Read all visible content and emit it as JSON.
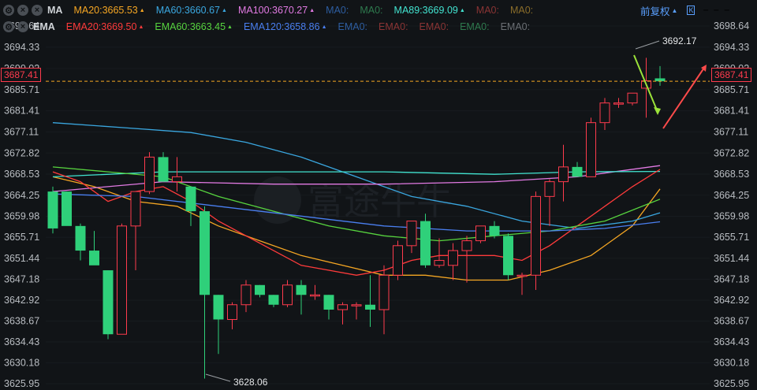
{
  "legend_ma": {
    "label": "MA",
    "items": [
      {
        "text": "MA20:3665.53",
        "color": "#f5a623",
        "arrow": "▲"
      },
      {
        "text": "MA60:3660.67",
        "color": "#3aa7e0",
        "arrow": "▲"
      },
      {
        "text": "MA100:3670.27",
        "color": "#e27ae3",
        "arrow": "▲"
      },
      {
        "text": "MA0:",
        "color": "#2d5da0",
        "arrow": ""
      },
      {
        "text": "MA0:",
        "color": "#2e7a4e",
        "arrow": ""
      },
      {
        "text": "MA89:3669.09",
        "color": "#42e3d0",
        "arrow": "▲"
      },
      {
        "text": "MA0:",
        "color": "#8a3434",
        "arrow": ""
      },
      {
        "text": "MA0:",
        "color": "#8a6d2a",
        "arrow": ""
      }
    ]
  },
  "legend_ema": {
    "label": "EMA",
    "items": [
      {
        "text": "EMA20:3669.50",
        "color": "#ff3b3b",
        "arrow": "▲"
      },
      {
        "text": "EMA60:3663.45",
        "color": "#57d43f",
        "arrow": "▲"
      },
      {
        "text": "EMA120:3658.86",
        "color": "#4a7ff0",
        "arrow": "▲"
      },
      {
        "text": "EMA0:",
        "color": "#2d5da0",
        "arrow": ""
      },
      {
        "text": "EMA0:",
        "color": "#8a3434",
        "arrow": ""
      },
      {
        "text": "EMA0:",
        "color": "#8a3434",
        "arrow": ""
      },
      {
        "text": "EMA0:",
        "color": "#2e7a4e",
        "arrow": ""
      },
      {
        "text": "EMA0:",
        "color": "#6b6f74",
        "arrow": ""
      }
    ]
  },
  "toolbar": {
    "adjust_label": "前复权",
    "collapse_icon": "chevron-up-icon",
    "kline_icon": "kline-icon"
  },
  "watermark": {
    "text": "富途牛牛"
  },
  "current_price": "3687.41",
  "annotations": {
    "high": "3692.17",
    "low": "3628.06"
  },
  "colors": {
    "up": "#ff3b4d",
    "down": "#2fd07a",
    "background": "#111417",
    "price_line": "#f5a623"
  },
  "chart_data": {
    "type": "candlestick",
    "ylim": [
      3625.95,
      3698.64
    ],
    "yticks": [
      "3698.64",
      "3694.33",
      "3690.02",
      "3685.71",
      "3681.41",
      "3677.11",
      "3672.82",
      "3668.53",
      "3664.25",
      "3659.98",
      "3655.71",
      "3651.44",
      "3647.18",
      "3642.92",
      "3638.67",
      "3634.43",
      "3630.18",
      "3625.95"
    ],
    "candles": [
      [
        3665.0,
        3666.0,
        3656.5,
        3657.5
      ],
      [
        3665.0,
        3665.0,
        3659.0,
        3658.0
      ],
      [
        3658.0,
        3658.5,
        3651.0,
        3653.0
      ],
      [
        3653.0,
        3657.0,
        3650.5,
        3650.0
      ],
      [
        3649.0,
        3649.0,
        3635.0,
        3636.0
      ],
      [
        3636.0,
        3658.5,
        3636.0,
        3658.0
      ],
      [
        3658.0,
        3665.0,
        3649.0,
        3665.0
      ],
      [
        3665.0,
        3673.0,
        3664.5,
        3672.0
      ],
      [
        3672.0,
        3673.0,
        3667.0,
        3667.0
      ],
      [
        3667.0,
        3672.0,
        3665.0,
        3668.0
      ],
      [
        3666.0,
        3666.0,
        3658.0,
        3661.0
      ],
      [
        3661.0,
        3662.0,
        3627.0,
        3644.0
      ],
      [
        3644.0,
        3644.0,
        3632.0,
        3639.0
      ],
      [
        3639.0,
        3642.5,
        3637.0,
        3642.0
      ],
      [
        3642.0,
        3647.0,
        3640.5,
        3646.0
      ],
      [
        3646.0,
        3646.0,
        3643.5,
        3644.0
      ],
      [
        3644.0,
        3644.0,
        3641.5,
        3642.0
      ],
      [
        3642.0,
        3647.0,
        3641.5,
        3646.0
      ],
      [
        3646.0,
        3647.0,
        3640.0,
        3644.0
      ],
      [
        3644.0,
        3646.0,
        3643.0,
        3644.0
      ],
      [
        3644.0,
        3644.0,
        3639.0,
        3641.0
      ],
      [
        3641.0,
        3642.5,
        3638.0,
        3642.0
      ],
      [
        3642.0,
        3642.5,
        3639.0,
        3642.0
      ],
      [
        3642.0,
        3648.0,
        3637.5,
        3641.0
      ],
      [
        3641.0,
        3650.0,
        3636.0,
        3648.0
      ],
      [
        3648.0,
        3655.0,
        3647.0,
        3654.0
      ],
      [
        3654.0,
        3659.0,
        3652.5,
        3659.0
      ],
      [
        3659.0,
        3660.5,
        3649.5,
        3650.0
      ],
      [
        3650.0,
        3655.5,
        3649.5,
        3651.0
      ],
      [
        3650.0,
        3654.5,
        3647.0,
        3653.0
      ],
      [
        3653.0,
        3656.0,
        3646.5,
        3655.0
      ],
      [
        3655.0,
        3658.0,
        3654.5,
        3658.0
      ],
      [
        3658.0,
        3659.0,
        3655.5,
        3656.0
      ],
      [
        3656.0,
        3656.5,
        3647.0,
        3648.0
      ],
      [
        3648.0,
        3648.5,
        3644.0,
        3648.0
      ],
      [
        3648.0,
        3665.0,
        3645.0,
        3664.0
      ],
      [
        3664.0,
        3667.5,
        3658.0,
        3667.0
      ],
      [
        3667.0,
        3674.5,
        3663.0,
        3670.0
      ],
      [
        3670.0,
        3671.0,
        3668.0,
        3668.0
      ],
      [
        3668.0,
        3680.0,
        3668.0,
        3679.0
      ],
      [
        3679.0,
        3684.0,
        3677.5,
        3683.0
      ],
      [
        3683.0,
        3684.0,
        3682.0,
        3683.0
      ],
      [
        3683.0,
        3685.0,
        3682.5,
        3685.0
      ],
      [
        3686.0,
        3692.17,
        3680.0,
        3687.5
      ],
      [
        3688.0,
        3690.5,
        3686.5,
        3687.41
      ]
    ],
    "lines": [
      {
        "name": "MA20",
        "color": "#f5a623",
        "points": [
          [
            0,
            3668
          ],
          [
            3,
            3666
          ],
          [
            6,
            3663
          ],
          [
            9,
            3662
          ],
          [
            12,
            3658
          ],
          [
            15,
            3655
          ],
          [
            18,
            3652
          ],
          [
            21,
            3650
          ],
          [
            24,
            3648
          ],
          [
            27,
            3648
          ],
          [
            30,
            3647
          ],
          [
            33,
            3647
          ],
          [
            36,
            3649
          ],
          [
            39,
            3652
          ],
          [
            42,
            3658
          ],
          [
            44,
            3665.53
          ]
        ]
      },
      {
        "name": "MA60",
        "color": "#3aa7e0",
        "points": [
          [
            0,
            3679
          ],
          [
            5,
            3678
          ],
          [
            10,
            3677
          ],
          [
            14,
            3675
          ],
          [
            18,
            3672
          ],
          [
            22,
            3668
          ],
          [
            26,
            3664
          ],
          [
            30,
            3662
          ],
          [
            34,
            3659
          ],
          [
            38,
            3657.5
          ],
          [
            42,
            3659
          ],
          [
            44,
            3660.67
          ]
        ]
      },
      {
        "name": "MA100",
        "color": "#e27ae3",
        "points": [
          [
            0,
            3665
          ],
          [
            8,
            3667
          ],
          [
            16,
            3666.5
          ],
          [
            24,
            3666.5
          ],
          [
            32,
            3667
          ],
          [
            38,
            3668
          ],
          [
            44,
            3670.27
          ]
        ]
      },
      {
        "name": "MA89",
        "color": "#42e3d0",
        "points": [
          [
            0,
            3668
          ],
          [
            8,
            3669
          ],
          [
            16,
            3669
          ],
          [
            24,
            3669
          ],
          [
            32,
            3668.5
          ],
          [
            38,
            3669
          ],
          [
            44,
            3669.09
          ]
        ]
      },
      {
        "name": "EMA20",
        "color": "#ff3b3b",
        "points": [
          [
            0,
            3669
          ],
          [
            2,
            3667
          ],
          [
            4,
            3663
          ],
          [
            6,
            3665
          ],
          [
            8,
            3666
          ],
          [
            10,
            3663
          ],
          [
            12,
            3659
          ],
          [
            14,
            3656
          ],
          [
            16,
            3653
          ],
          [
            18,
            3650
          ],
          [
            20,
            3649
          ],
          [
            22,
            3648
          ],
          [
            24,
            3649
          ],
          [
            26,
            3651
          ],
          [
            28,
            3652
          ],
          [
            30,
            3652
          ],
          [
            32,
            3652
          ],
          [
            34,
            3651
          ],
          [
            36,
            3654
          ],
          [
            38,
            3658
          ],
          [
            40,
            3662
          ],
          [
            42,
            3666
          ],
          [
            44,
            3669.5
          ]
        ]
      },
      {
        "name": "EMA60",
        "color": "#57d43f",
        "points": [
          [
            0,
            3670
          ],
          [
            4,
            3669
          ],
          [
            8,
            3668
          ],
          [
            12,
            3664
          ],
          [
            16,
            3661
          ],
          [
            20,
            3658
          ],
          [
            24,
            3656
          ],
          [
            28,
            3655
          ],
          [
            32,
            3656
          ],
          [
            36,
            3657
          ],
          [
            40,
            3659
          ],
          [
            44,
            3663.45
          ]
        ]
      },
      {
        "name": "EMA120",
        "color": "#4a7ff0",
        "points": [
          [
            0,
            3664.5
          ],
          [
            6,
            3664
          ],
          [
            12,
            3662
          ],
          [
            18,
            3660
          ],
          [
            24,
            3658
          ],
          [
            30,
            3657
          ],
          [
            36,
            3657
          ],
          [
            40,
            3657.5
          ],
          [
            44,
            3658.86
          ]
        ]
      }
    ]
  }
}
